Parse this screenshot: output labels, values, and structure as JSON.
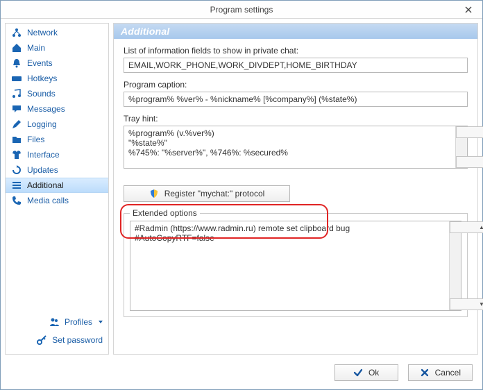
{
  "windowTitle": "Program settings",
  "panelTitle": "Additional",
  "sidebar": {
    "items": [
      {
        "label": "Network"
      },
      {
        "label": "Main"
      },
      {
        "label": "Events"
      },
      {
        "label": "Hotkeys"
      },
      {
        "label": "Sounds"
      },
      {
        "label": "Messages"
      },
      {
        "label": "Logging"
      },
      {
        "label": "Files"
      },
      {
        "label": "Interface"
      },
      {
        "label": "Updates"
      },
      {
        "label": "Additional"
      },
      {
        "label": "Media calls"
      }
    ],
    "profilesLabel": "Profiles",
    "setPasswordLabel": "Set password"
  },
  "form": {
    "fieldsLabel": "List of information fields to show in private chat:",
    "fieldsValue": "EMAIL,WORK_PHONE,WORK_DIVDEPT,HOME_BIRTHDAY",
    "captionLabel": "Program caption:",
    "captionValue": "%program% %ver% - %nickname% [%company%] (%state%)",
    "trayLabel": "Tray hint:",
    "trayValue": "%program% (v.%ver%)\n\"%state%\"\n%745%: \"%server%\", %746%: %secured%",
    "registerLabel": "Register \"mychat:\" protocol",
    "extLegend": "Extended options",
    "extValue": "#Radmin (https://www.radmin.ru) remote set clipboard bug\n#AutoCopyRTF=false"
  },
  "buttons": {
    "ok": "Ok",
    "cancel": "Cancel"
  }
}
